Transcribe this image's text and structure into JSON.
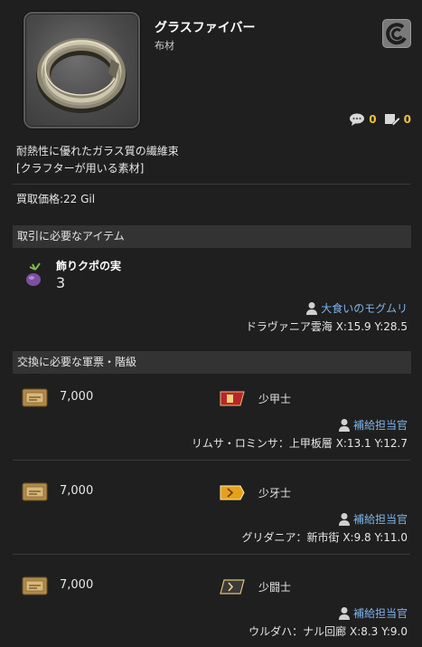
{
  "item": {
    "name": "グラスファイバー",
    "category": "布材",
    "icon": "glass-fiber-ring-icon",
    "comment_count": "0",
    "report_count": "0",
    "description_line1": "耐熱性に優れたガラス質の繊維束",
    "description_line2": "[クラフターが用いる素材]",
    "price": "買取価格:22 Gil"
  },
  "trade_section": {
    "title": "取引に必要なアイテム",
    "required_item": {
      "name": "飾りクポの実",
      "quantity": "3",
      "icon": "kupo-fruit-icon"
    },
    "npc": "大食いのモグムリ",
    "location": "ドラヴァニア雲海 X:15.9 Y:28.5"
  },
  "exchange_section": {
    "title": "交換に必要な軍票・階級",
    "entries": [
      {
        "amount": "7,000",
        "rank": "少甲士",
        "rank_color": "#c0392b",
        "npc": "補給担当官",
        "location": "リムサ・ロミンサ：上甲板層 X:13.1 Y:12.7"
      },
      {
        "amount": "7,000",
        "rank": "少牙士",
        "rank_color": "#e6a11c",
        "npc": "補給担当官",
        "location": "グリダニア：新市街 X:9.8 Y:11.0"
      },
      {
        "amount": "7,000",
        "rank": "少闘士",
        "rank_color": "#4a4a4a",
        "npc": "補給担当官",
        "location": "ウルダハ：ナル回廊 X:8.3 Y:9.0"
      }
    ]
  },
  "colors": {
    "background": "#1f1f1f",
    "section_header": "#333333",
    "link": "#7fb4ea",
    "count": "#f0c23a"
  }
}
